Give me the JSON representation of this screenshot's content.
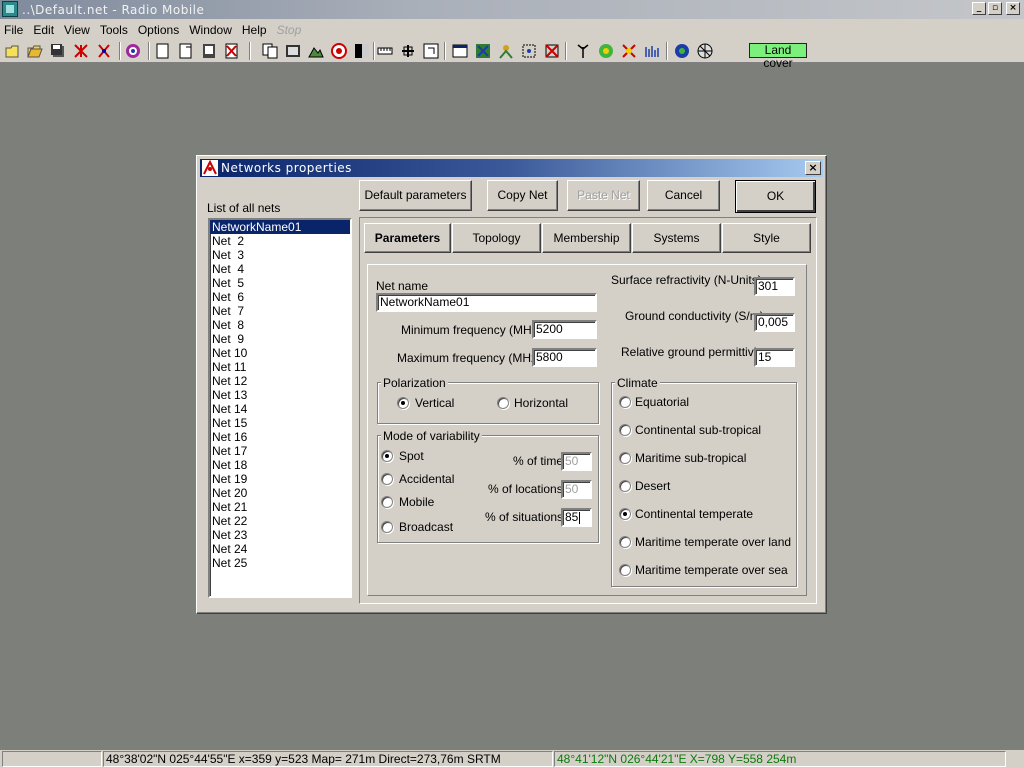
{
  "app": {
    "title": "..\\Default.net - Radio Mobile"
  },
  "menu": [
    "File",
    "Edit",
    "View",
    "Tools",
    "Options",
    "Window",
    "Help",
    "Stop"
  ],
  "toolbar": {
    "land_cover_label": "Land cover",
    "land_cover_color": "#7cf07c"
  },
  "status": {
    "pane1": "48°38'02\"N  025°44'55\"E   x=359 y=523 Map= 271m Direct=273,76m SRTM",
    "pane2": "48°41'12\"N 026°44'21\"E  X=798 Y=558 254m"
  },
  "dialog": {
    "title": "Networks properties",
    "list_label": "List of all nets",
    "nets": [
      "NetworkName01",
      "Net  2",
      "Net  3",
      "Net  4",
      "Net  5",
      "Net  6",
      "Net  7",
      "Net  8",
      "Net  9",
      "Net 10",
      "Net 11",
      "Net 12",
      "Net 13",
      "Net 14",
      "Net 15",
      "Net 16",
      "Net 17",
      "Net 18",
      "Net 19",
      "Net 20",
      "Net 21",
      "Net 22",
      "Net 23",
      "Net 24",
      "Net 25"
    ],
    "buttons": {
      "default_params": "Default parameters",
      "copy_net": "Copy Net",
      "paste_net": "Paste Net",
      "cancel": "Cancel",
      "ok": "OK"
    },
    "tabs": [
      "Parameters",
      "Topology",
      "Membership",
      "Systems",
      "Style"
    ],
    "params": {
      "net_name_label": "Net name",
      "net_name": "NetworkName01",
      "min_freq_label": "Minimum frequency (MHz)",
      "min_freq": "5200",
      "max_freq_label": "Maximum frequency (MHz)",
      "max_freq": "5800",
      "polarization_label": "Polarization",
      "vertical": "Vertical",
      "horizontal": "Horizontal",
      "variability_label": "Mode of variability",
      "spot": "Spot",
      "accidental": "Accidental",
      "mobile": "Mobile",
      "broadcast": "Broadcast",
      "pct_time_label": "% of time",
      "pct_time": "50",
      "pct_locations_label": "% of locations",
      "pct_locations": "50",
      "pct_situations_label": "% of situations",
      "pct_situations": "85",
      "surface_refractivity_label": "Surface refractivity (N-Units)",
      "surface_refractivity": "301",
      "ground_conductivity_label": "Ground conductivity (S/m)",
      "ground_conductivity": "0,005",
      "ground_permittivity_label": "Relative ground permittivity",
      "ground_permittivity": "15",
      "climate_label": "Climate",
      "climates": [
        "Equatorial",
        "Continental sub-tropical",
        "Maritime sub-tropical",
        "Desert",
        "Continental temperate",
        "Maritime temperate over land",
        "Maritime temperate over sea"
      ]
    }
  }
}
